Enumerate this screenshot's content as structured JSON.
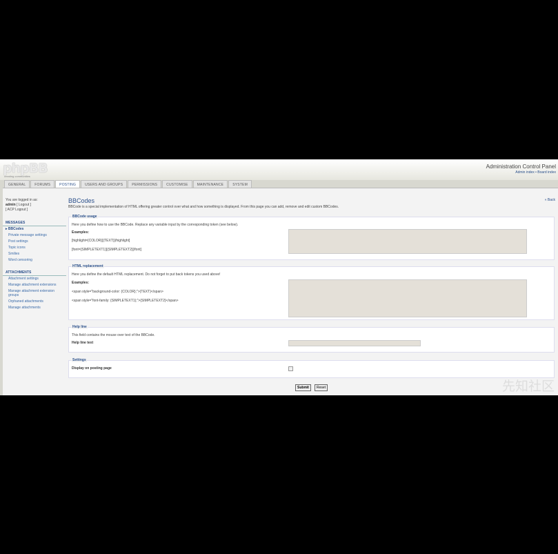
{
  "header": {
    "logo": "phpBB",
    "logo_sub": "creating communities",
    "acp_title": "Administration Control Panel",
    "acp_links": "Admin index • Board index"
  },
  "tabs": [
    "GENERAL",
    "FORUMS",
    "POSTING",
    "USERS AND GROUPS",
    "PERMISSIONS",
    "CUSTOMISE",
    "MAINTENANCE",
    "SYSTEM"
  ],
  "active_tab": "POSTING",
  "sidebar": {
    "login_line1": "You are logged in as:",
    "login_user": "admin",
    "login_logout": "[ Logout ]",
    "login_acp_logout": "[ ACP Logout ]",
    "sections": [
      {
        "title": "MESSAGES",
        "items": [
          "BBCodes",
          "Private message settings",
          "Post settings",
          "Topic icons",
          "Smilies",
          "Word censoring"
        ]
      },
      {
        "title": "ATTACHMENTS",
        "items": [
          "Attachment settings",
          "Manage attachment extensions",
          "Manage attachment extension groups",
          "Orphaned attachments",
          "Manage attachments"
        ]
      }
    ]
  },
  "main": {
    "title": "BBCodes",
    "back_link": "« Back",
    "intro": "BBCode is a special implementation of HTML offering greater control over what and how something is displayed. From this page you can add, remove and edit custom BBCodes.",
    "usage": {
      "legend": "BBCode usage",
      "desc": "Here you define how to use the BBCode. Replace any variable input by the corresponding token (see below).",
      "examples_label": "Examples:",
      "example1": "[highlight={COLOR}]{TEXT}[/highlight]",
      "example2": "[font={SIMPLETEXT1}]{SIMPLETEXT2}[/font]"
    },
    "html": {
      "legend": "HTML replacement",
      "desc": "Here you define the default HTML replacement. Do not forget to put back tokens you used above!",
      "examples_label": "Examples:",
      "example1": "<span style=\"background-color: {COLOR};\">{TEXT}</span>",
      "example2": "<span style=\"font-family: {SIMPLETEXT1};\">{SIMPLETEXT2}</span>"
    },
    "helpline": {
      "legend": "Help line",
      "desc": "This field contains the mouse over text of the BBCode.",
      "label": "Help line text"
    },
    "settings": {
      "legend": "Settings",
      "label": "Display on posting page"
    },
    "submit": "Submit",
    "reset": "Reset"
  },
  "watermark": "先知社区",
  "colors": {
    "accent": "#2a4f8a",
    "link": "#3a6aa8",
    "page_bg": "#000000"
  }
}
